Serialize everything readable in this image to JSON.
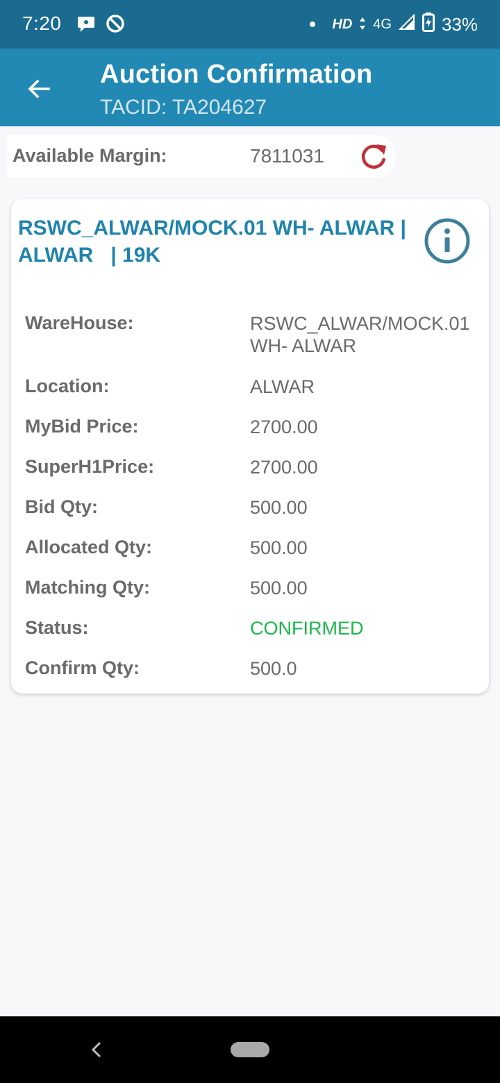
{
  "status_bar": {
    "time": "7:20",
    "icons_left": [
      "chat-icon",
      "do-not-disturb-icon"
    ],
    "hd": "HD",
    "network": "4G",
    "battery": "33%"
  },
  "app_bar": {
    "title": "Auction Confirmation",
    "subtitle": "TACID: TA204627"
  },
  "margin": {
    "label": "Available Margin:",
    "value": "7811031",
    "refresh_color": "#c0303a"
  },
  "card": {
    "title": "RSWC_ALWAR/MOCK.01 WH- ALWAR |\nALWAR   | 19K",
    "rows": [
      {
        "label": "WareHouse:",
        "value": "RSWC_ALWAR/MOCK.01 WH- ALWAR"
      },
      {
        "label": "Location:",
        "value": "ALWAR"
      },
      {
        "label": "MyBid Price:",
        "value": "2700.00"
      },
      {
        "label": "SuperH1Price:",
        "value": "2700.00"
      },
      {
        "label": "Bid Qty:",
        "value": "500.00"
      },
      {
        "label": "Allocated Qty:",
        "value": "500.00"
      },
      {
        "label": "Matching Qty:",
        "value": "500.00"
      },
      {
        "label": "Status:",
        "value": "CONFIRMED"
      },
      {
        "label": "Confirm Qty:",
        "value": "500.0"
      }
    ]
  },
  "colors": {
    "status_bar": "#1a6b8f",
    "app_bar": "#2189b4",
    "card_title": "#1f84ad",
    "status_confirmed": "#1cb84a"
  }
}
